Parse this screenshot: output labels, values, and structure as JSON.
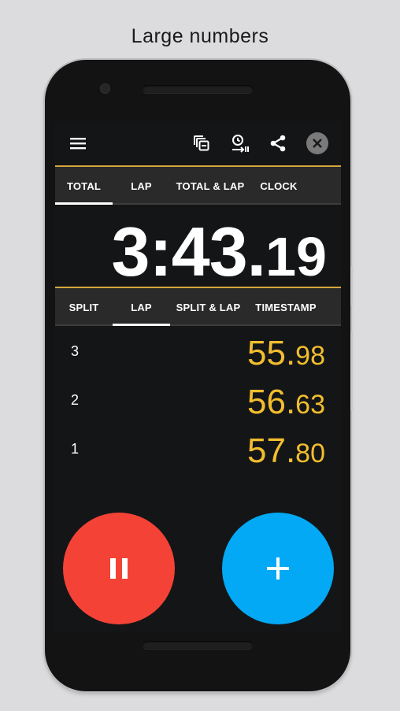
{
  "caption": "Large numbers",
  "toolbar": {
    "icons": [
      "menu-icon",
      "copy-laps-icon",
      "timer-export-icon",
      "share-icon",
      "close-icon"
    ]
  },
  "colors": {
    "accent_gold": "#d4a83a",
    "lap_time": "#f2be2e",
    "pause_button": "#f44336",
    "add_button": "#03a9f4"
  },
  "display_tabs": {
    "selected": "TOTAL",
    "items": [
      {
        "label": "TOTAL"
      },
      {
        "label": "LAP"
      },
      {
        "label": "TOTAL & LAP"
      },
      {
        "label": "CLOCK"
      }
    ]
  },
  "timer": {
    "main": "3:43.",
    "fraction": "19"
  },
  "list_tabs": {
    "selected": "LAP",
    "items": [
      {
        "label": "SPLIT"
      },
      {
        "label": "LAP"
      },
      {
        "label": "SPLIT & LAP"
      },
      {
        "label": "TIMESTAMP"
      }
    ]
  },
  "laps": [
    {
      "number": "3",
      "main": "55.",
      "fraction": "98"
    },
    {
      "number": "2",
      "main": "56.",
      "fraction": "63"
    },
    {
      "number": "1",
      "main": "57.",
      "fraction": "80"
    }
  ],
  "buttons": {
    "pause": "pause-icon",
    "add_lap": "plus-icon"
  }
}
